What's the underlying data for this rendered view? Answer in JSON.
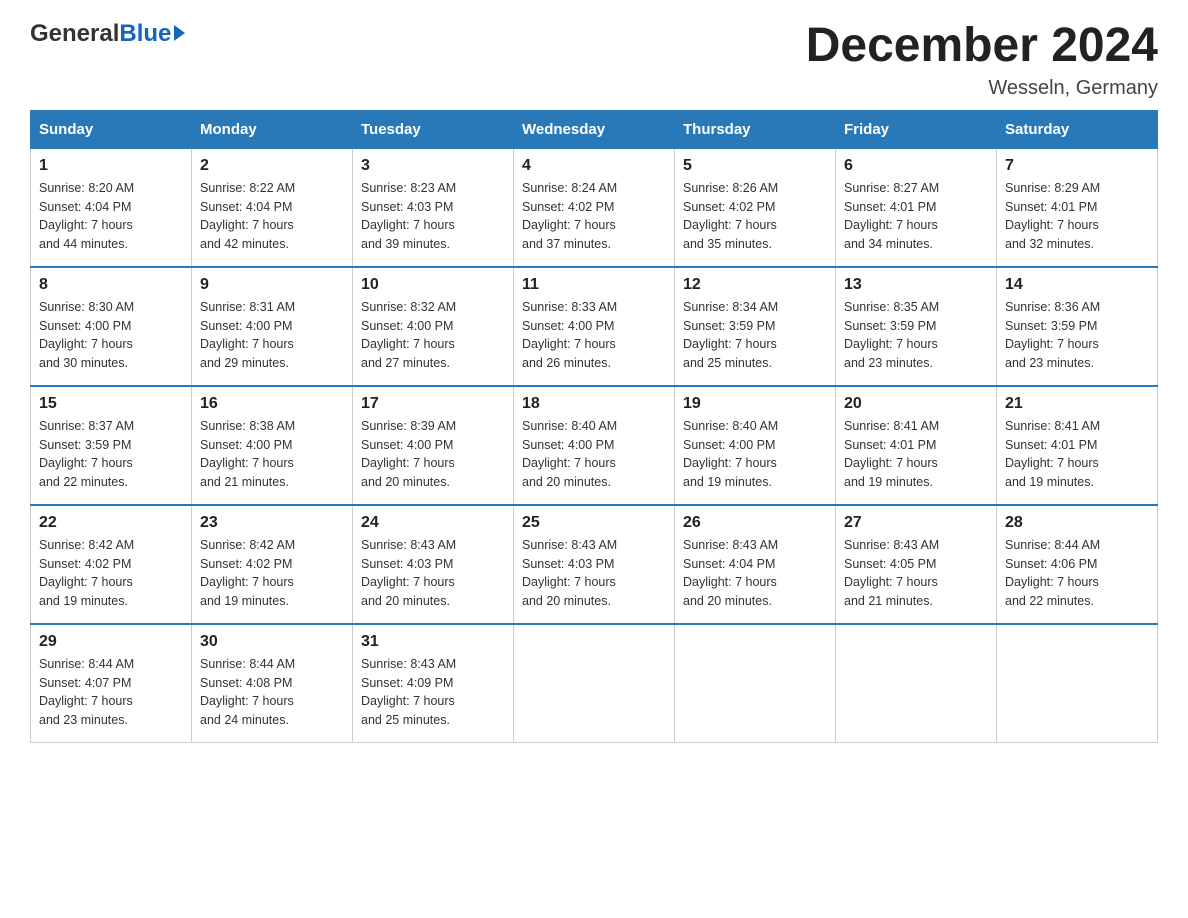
{
  "header": {
    "title": "December 2024",
    "location": "Wesseln, Germany",
    "logo_general": "General",
    "logo_blue": "Blue"
  },
  "days_of_week": [
    "Sunday",
    "Monday",
    "Tuesday",
    "Wednesday",
    "Thursday",
    "Friday",
    "Saturday"
  ],
  "weeks": [
    [
      {
        "day": "1",
        "sunrise": "8:20 AM",
        "sunset": "4:04 PM",
        "daylight": "7 hours and 44 minutes."
      },
      {
        "day": "2",
        "sunrise": "8:22 AM",
        "sunset": "4:04 PM",
        "daylight": "7 hours and 42 minutes."
      },
      {
        "day": "3",
        "sunrise": "8:23 AM",
        "sunset": "4:03 PM",
        "daylight": "7 hours and 39 minutes."
      },
      {
        "day": "4",
        "sunrise": "8:24 AM",
        "sunset": "4:02 PM",
        "daylight": "7 hours and 37 minutes."
      },
      {
        "day": "5",
        "sunrise": "8:26 AM",
        "sunset": "4:02 PM",
        "daylight": "7 hours and 35 minutes."
      },
      {
        "day": "6",
        "sunrise": "8:27 AM",
        "sunset": "4:01 PM",
        "daylight": "7 hours and 34 minutes."
      },
      {
        "day": "7",
        "sunrise": "8:29 AM",
        "sunset": "4:01 PM",
        "daylight": "7 hours and 32 minutes."
      }
    ],
    [
      {
        "day": "8",
        "sunrise": "8:30 AM",
        "sunset": "4:00 PM",
        "daylight": "7 hours and 30 minutes."
      },
      {
        "day": "9",
        "sunrise": "8:31 AM",
        "sunset": "4:00 PM",
        "daylight": "7 hours and 29 minutes."
      },
      {
        "day": "10",
        "sunrise": "8:32 AM",
        "sunset": "4:00 PM",
        "daylight": "7 hours and 27 minutes."
      },
      {
        "day": "11",
        "sunrise": "8:33 AM",
        "sunset": "4:00 PM",
        "daylight": "7 hours and 26 minutes."
      },
      {
        "day": "12",
        "sunrise": "8:34 AM",
        "sunset": "3:59 PM",
        "daylight": "7 hours and 25 minutes."
      },
      {
        "day": "13",
        "sunrise": "8:35 AM",
        "sunset": "3:59 PM",
        "daylight": "7 hours and 23 minutes."
      },
      {
        "day": "14",
        "sunrise": "8:36 AM",
        "sunset": "3:59 PM",
        "daylight": "7 hours and 23 minutes."
      }
    ],
    [
      {
        "day": "15",
        "sunrise": "8:37 AM",
        "sunset": "3:59 PM",
        "daylight": "7 hours and 22 minutes."
      },
      {
        "day": "16",
        "sunrise": "8:38 AM",
        "sunset": "4:00 PM",
        "daylight": "7 hours and 21 minutes."
      },
      {
        "day": "17",
        "sunrise": "8:39 AM",
        "sunset": "4:00 PM",
        "daylight": "7 hours and 20 minutes."
      },
      {
        "day": "18",
        "sunrise": "8:40 AM",
        "sunset": "4:00 PM",
        "daylight": "7 hours and 20 minutes."
      },
      {
        "day": "19",
        "sunrise": "8:40 AM",
        "sunset": "4:00 PM",
        "daylight": "7 hours and 19 minutes."
      },
      {
        "day": "20",
        "sunrise": "8:41 AM",
        "sunset": "4:01 PM",
        "daylight": "7 hours and 19 minutes."
      },
      {
        "day": "21",
        "sunrise": "8:41 AM",
        "sunset": "4:01 PM",
        "daylight": "7 hours and 19 minutes."
      }
    ],
    [
      {
        "day": "22",
        "sunrise": "8:42 AM",
        "sunset": "4:02 PM",
        "daylight": "7 hours and 19 minutes."
      },
      {
        "day": "23",
        "sunrise": "8:42 AM",
        "sunset": "4:02 PM",
        "daylight": "7 hours and 19 minutes."
      },
      {
        "day": "24",
        "sunrise": "8:43 AM",
        "sunset": "4:03 PM",
        "daylight": "7 hours and 20 minutes."
      },
      {
        "day": "25",
        "sunrise": "8:43 AM",
        "sunset": "4:03 PM",
        "daylight": "7 hours and 20 minutes."
      },
      {
        "day": "26",
        "sunrise": "8:43 AM",
        "sunset": "4:04 PM",
        "daylight": "7 hours and 20 minutes."
      },
      {
        "day": "27",
        "sunrise": "8:43 AM",
        "sunset": "4:05 PM",
        "daylight": "7 hours and 21 minutes."
      },
      {
        "day": "28",
        "sunrise": "8:44 AM",
        "sunset": "4:06 PM",
        "daylight": "7 hours and 22 minutes."
      }
    ],
    [
      {
        "day": "29",
        "sunrise": "8:44 AM",
        "sunset": "4:07 PM",
        "daylight": "7 hours and 23 minutes."
      },
      {
        "day": "30",
        "sunrise": "8:44 AM",
        "sunset": "4:08 PM",
        "daylight": "7 hours and 24 minutes."
      },
      {
        "day": "31",
        "sunrise": "8:43 AM",
        "sunset": "4:09 PM",
        "daylight": "7 hours and 25 minutes."
      },
      null,
      null,
      null,
      null
    ]
  ],
  "labels": {
    "sunrise": "Sunrise:",
    "sunset": "Sunset:",
    "daylight": "Daylight:"
  }
}
